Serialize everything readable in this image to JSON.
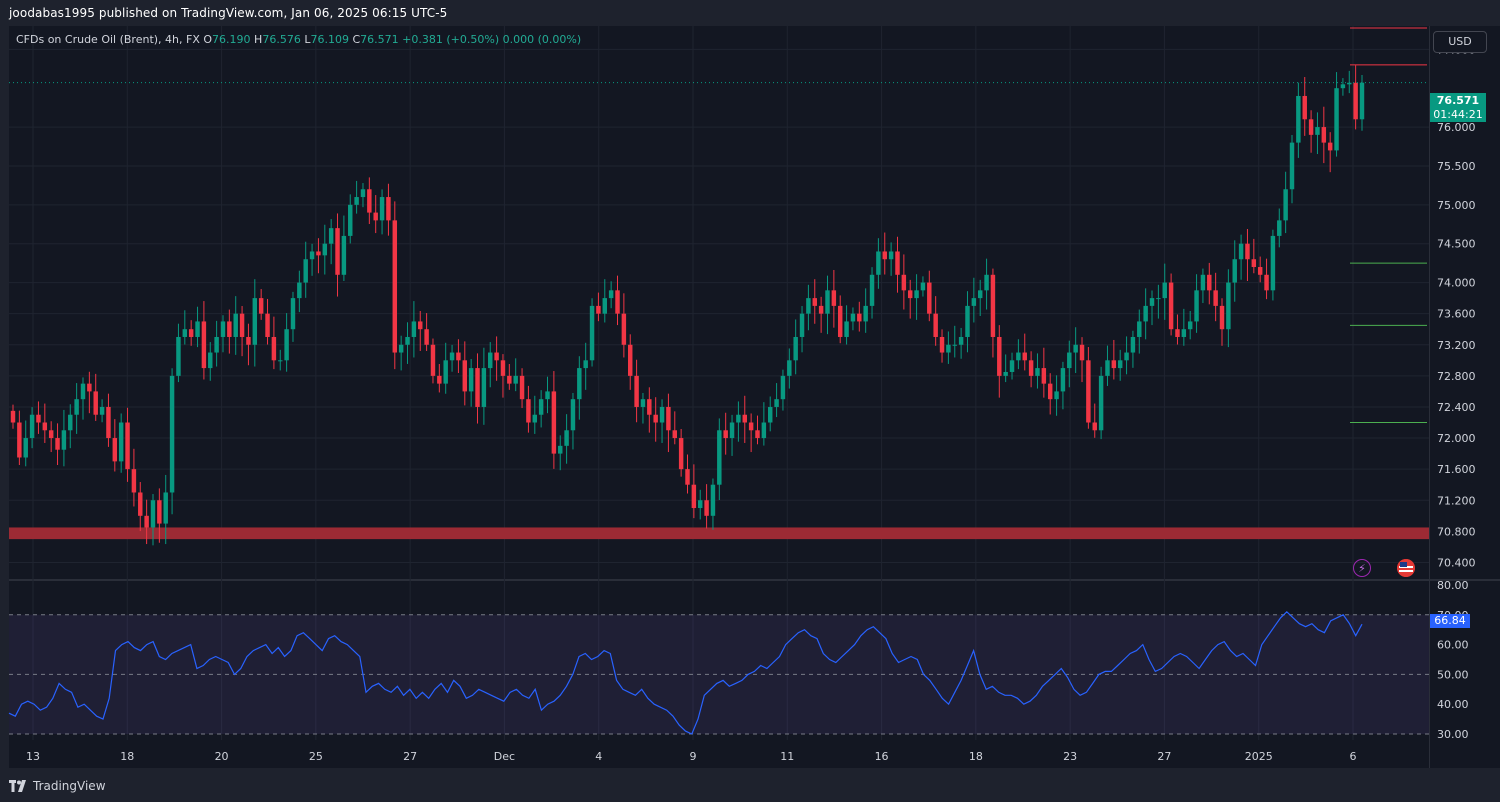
{
  "header": {
    "published_text": "joodabas1995 published on TradingView.com, Jan 06, 2025 06:15 UTC-5"
  },
  "legend": {
    "symbol": "CFDs on Crude Oil (Brent), 4h, FX",
    "open_label": "O",
    "open": "76.190",
    "high_label": "H",
    "high": "76.576",
    "low_label": "L",
    "low": "76.109",
    "close_label": "C",
    "close": "76.571",
    "change": "+0.381 (+0.50%)",
    "extra": "0.000 (0.00%)"
  },
  "price_axis": {
    "currency_button": "USD",
    "labels": [
      "77.000",
      "76.000",
      "75.500",
      "75.000",
      "74.500",
      "74.000",
      "73.600",
      "73.200",
      "72.800",
      "72.400",
      "72.000",
      "71.600",
      "71.200",
      "70.800",
      "70.400"
    ],
    "last_price": "76.571",
    "countdown": "01:44:21"
  },
  "rsi_axis": {
    "labels": [
      "80.00",
      "70.00",
      "60.00",
      "50.00",
      "40.00",
      "30.00"
    ],
    "current": "66.84"
  },
  "time_axis": {
    "labels": [
      "13",
      "18",
      "20",
      "25",
      "27",
      "Dec",
      "4",
      "9",
      "11",
      "16",
      "18",
      "23",
      "27",
      "2025",
      "6"
    ]
  },
  "footer": {
    "brand": "TradingView"
  },
  "colors": {
    "bull": "#089981",
    "bear": "#f23645",
    "rsi_line": "#2962ff",
    "support_zone": "#9c2a34",
    "background": "#131722"
  },
  "icons": {
    "alert": "lightning-icon",
    "flag": "us-flag-icon",
    "logo": "tradingview-logo-icon"
  },
  "chart_data": {
    "type": "candlestick",
    "instrument": "CFDs on Crude Oil (Brent)",
    "timeframe": "4h",
    "ylim": [
      70.2,
      77.3
    ],
    "rsi_ylim": [
      28,
      81
    ],
    "rsi_levels": [
      70,
      50,
      30
    ],
    "x_ticks": [
      "13",
      "18",
      "20",
      "25",
      "27",
      "Dec",
      "4",
      "9",
      "11",
      "16",
      "18",
      "23",
      "27",
      "2025",
      "6"
    ],
    "support_zone": [
      70.7,
      70.85
    ],
    "horizontal_lines": [
      {
        "price": 77.6,
        "color": "#f23645"
      },
      {
        "price": 76.8,
        "color": "#f23645"
      },
      {
        "price": 74.25,
        "color": "#4caf50"
      },
      {
        "price": 73.45,
        "color": "#4caf50"
      },
      {
        "price": 72.2,
        "color": "#4caf50"
      }
    ],
    "close_path": [
      72.2,
      71.75,
      72.0,
      72.3,
      72.2,
      72.1,
      72.0,
      71.85,
      72.1,
      72.3,
      72.5,
      72.7,
      72.6,
      72.3,
      72.4,
      72.0,
      71.7,
      72.2,
      71.6,
      71.3,
      71.0,
      70.85,
      71.2,
      70.9,
      71.3,
      72.8,
      73.3,
      73.4,
      73.3,
      73.5,
      72.9,
      73.1,
      73.3,
      73.5,
      73.3,
      73.6,
      73.3,
      73.2,
      73.8,
      73.6,
      73.3,
      73.0,
      73.0,
      73.4,
      73.8,
      74.0,
      74.3,
      74.4,
      74.35,
      74.5,
      74.7,
      74.1,
      74.6,
      75.0,
      75.1,
      75.2,
      74.9,
      74.8,
      75.1,
      74.8,
      73.1,
      73.2,
      73.3,
      73.5,
      73.4,
      73.2,
      72.8,
      72.7,
      73.0,
      73.1,
      73.0,
      72.6,
      72.9,
      72.4,
      72.9,
      73.1,
      73.0,
      72.8,
      72.7,
      72.8,
      72.5,
      72.2,
      72.3,
      72.5,
      72.6,
      71.8,
      71.9,
      72.1,
      72.5,
      72.9,
      73.0,
      73.7,
      73.6,
      73.8,
      73.9,
      73.6,
      73.2,
      72.8,
      72.4,
      72.5,
      72.3,
      72.2,
      72.4,
      72.1,
      72.0,
      71.6,
      71.4,
      71.1,
      71.2,
      71.0,
      71.4,
      72.1,
      72.0,
      72.2,
      72.3,
      72.2,
      72.1,
      72.0,
      72.2,
      72.4,
      72.5,
      72.8,
      73.0,
      73.3,
      73.6,
      73.8,
      73.7,
      73.6,
      73.9,
      73.7,
      73.3,
      73.5,
      73.6,
      73.5,
      73.7,
      74.1,
      74.4,
      74.3,
      74.4,
      74.1,
      73.9,
      73.8,
      73.9,
      74.0,
      73.6,
      73.3,
      73.1,
      73.2,
      73.2,
      73.3,
      73.7,
      73.8,
      73.9,
      74.1,
      73.3,
      72.8,
      72.85,
      73.0,
      73.1,
      73.0,
      72.8,
      72.9,
      72.7,
      72.5,
      72.6,
      72.9,
      73.1,
      73.2,
      73.0,
      72.2,
      72.1,
      72.8,
      73.0,
      72.9,
      73.0,
      73.1,
      73.3,
      73.5,
      73.7,
      73.8,
      73.8,
      74.0,
      73.4,
      73.3,
      73.4,
      73.5,
      73.9,
      74.1,
      73.9,
      73.7,
      73.4,
      74.0,
      74.3,
      74.5,
      74.3,
      74.2,
      74.1,
      73.9,
      74.6,
      74.8,
      75.2,
      75.8,
      76.4,
      76.1,
      75.9,
      76.0,
      75.8,
      75.7,
      76.5,
      76.55,
      76.57,
      76.1,
      76.571
    ],
    "rsi_path": [
      37,
      36,
      40,
      41,
      40,
      38,
      39,
      42,
      47,
      45,
      44,
      39,
      40,
      38,
      36,
      35,
      42,
      58,
      60,
      61,
      59,
      58,
      60,
      61,
      56,
      55,
      57,
      58,
      59,
      60,
      52,
      53,
      55,
      56,
      55,
      54,
      50,
      52,
      56,
      58,
      59,
      60,
      57,
      59,
      56,
      58,
      63,
      64,
      62,
      60,
      58,
      62,
      63,
      61,
      60,
      58,
      56,
      44,
      46,
      47,
      45,
      44,
      46,
      43,
      45,
      42,
      44,
      42,
      45,
      47,
      44,
      48,
      46,
      42,
      43,
      45,
      44,
      43,
      42,
      41,
      44,
      45,
      43,
      42,
      45,
      38,
      40,
      41,
      43,
      46,
      50,
      56,
      57,
      55,
      56,
      58,
      57,
      48,
      45,
      44,
      43,
      45,
      42,
      40,
      39,
      38,
      36,
      33,
      31,
      30,
      35,
      43,
      45,
      47,
      48,
      46,
      47,
      48,
      50,
      51,
      53,
      52,
      54,
      56,
      60,
      62,
      64,
      65,
      63,
      62,
      57,
      55,
      54,
      56,
      58,
      60,
      63,
      65,
      66,
      64,
      62,
      57,
      54,
      55,
      56,
      55,
      50,
      48,
      45,
      42,
      40,
      44,
      48,
      53,
      58,
      50,
      45,
      46,
      44,
      43,
      43,
      42,
      40,
      41,
      43,
      46,
      48,
      50,
      52,
      49,
      45,
      43,
      44,
      47,
      50,
      51,
      51,
      53,
      55,
      57,
      58,
      60,
      55,
      51,
      52,
      54,
      56,
      57,
      56,
      54,
      52,
      55,
      58,
      60,
      61,
      58,
      56,
      57,
      55,
      53,
      60,
      63,
      66,
      69,
      71,
      69,
      67,
      66,
      67,
      65,
      64,
      68,
      69,
      70,
      67,
      63,
      66.84
    ]
  }
}
